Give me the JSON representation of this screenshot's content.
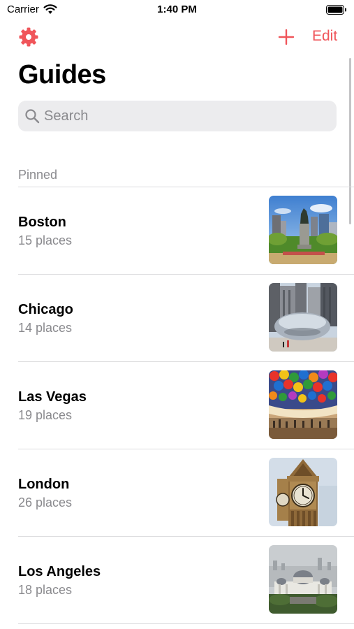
{
  "status_bar": {
    "carrier": "Carrier",
    "time": "1:40 PM"
  },
  "nav": {
    "edit_label": "Edit"
  },
  "title": "Guides",
  "search": {
    "placeholder": "Search"
  },
  "section": {
    "header": "Pinned"
  },
  "accent_color": "#f0555a",
  "guides": [
    {
      "name": "Boston",
      "count": "15 places",
      "image": "statue"
    },
    {
      "name": "Chicago",
      "count": "14 places",
      "image": "bean"
    },
    {
      "name": "Las Vegas",
      "count": "19 places",
      "image": "glass-ceiling"
    },
    {
      "name": "London",
      "count": "26 places",
      "image": "clock-tower"
    },
    {
      "name": "Los Angeles",
      "count": "18 places",
      "image": "observatory"
    }
  ]
}
